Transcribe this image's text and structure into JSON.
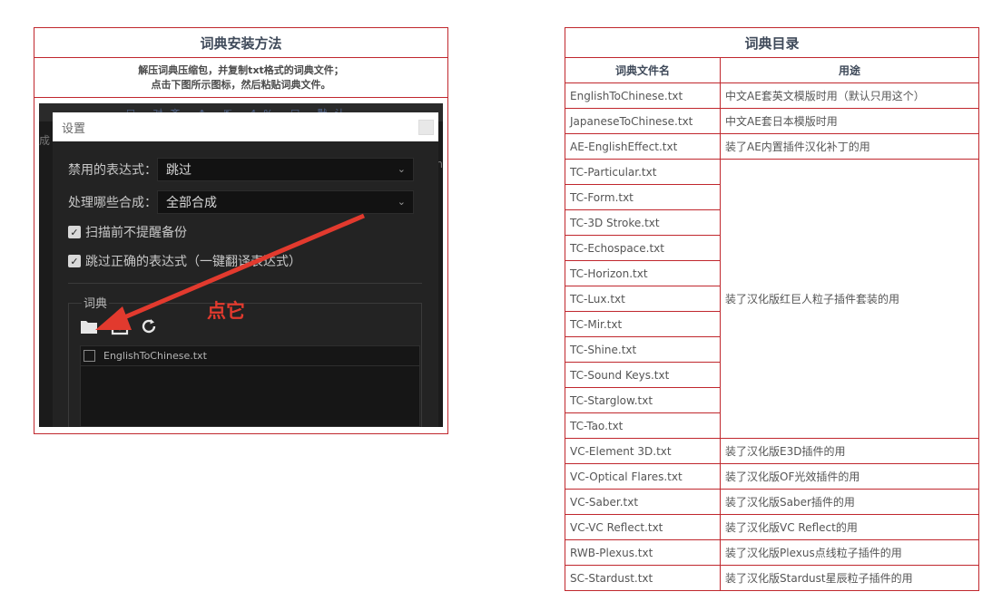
{
  "install": {
    "title": "词典安装方法",
    "desc_line1": "解压词典压缩包，并复制txt格式的词典文件；",
    "desc_line2": "点击下图所示图标，然后粘贴词典文件。"
  },
  "screenshot": {
    "bg_left_text": "成",
    "bg_right_text": "n",
    "bg_top_text": "☐ 对齐   ↕ ⇱   4%  ☐ 默认",
    "dialog_title": "设置",
    "disabled_expr_label": "禁用的表达式：",
    "disabled_expr_value": "跳过",
    "which_comps_label": "处理哪些合成：",
    "which_comps_value": "全部合成",
    "checkbox1_label": "扫描前不提醒备份",
    "checkbox2_label": "跳过正确的表达式（一键翻译表达式）",
    "dict_section_label": "词典",
    "file_item": "EnglishToChinese.txt",
    "annotation": "点它",
    "icons": [
      "folder-icon",
      "download-icon",
      "refresh-icon"
    ]
  },
  "dict_table": {
    "title": "词典目录",
    "col1_header": "词典文件名",
    "col2_header": "用途",
    "rows": [
      {
        "name": "EnglishToChinese.txt"
      },
      {
        "name": "JapaneseToChinese.txt"
      },
      {
        "name": "AE-EnglishEffect.txt"
      },
      {
        "name": "TC-Particular.txt"
      },
      {
        "name": "TC-Form.txt"
      },
      {
        "name": "TC-3D Stroke.txt"
      },
      {
        "name": "TC-Echospace.txt"
      },
      {
        "name": "TC-Horizon.txt"
      },
      {
        "name": "TC-Lux.txt"
      },
      {
        "name": "TC-Mir.txt"
      },
      {
        "name": "TC-Shine.txt"
      },
      {
        "name": "TC-Sound Keys.txt"
      },
      {
        "name": "TC-Starglow.txt"
      },
      {
        "name": "TC-Tao.txt"
      },
      {
        "name": "VC-Element 3D.txt"
      },
      {
        "name": "VC-Optical Flares.txt"
      },
      {
        "name": "VC-Saber.txt"
      },
      {
        "name": "VC-VC Reflect.txt"
      },
      {
        "name": "RWB-Plexus.txt"
      },
      {
        "name": "SC-Stardust.txt"
      }
    ],
    "uses": [
      {
        "text": "中文AE套英文模版时用（默认只用这个）",
        "rows": [
          0
        ]
      },
      {
        "text": "中文AE套日本模版时用",
        "rows": [
          1
        ]
      },
      {
        "text": "装了AE内置插件汉化补丁的用",
        "rows": [
          2
        ]
      },
      {
        "text": "装了汉化版红巨人粒子插件套装的用",
        "rows": [
          3,
          13
        ]
      },
      {
        "text": "装了汉化版E3D插件的用",
        "rows": [
          14
        ]
      },
      {
        "text": "装了汉化版OF光效插件的用",
        "rows": [
          15
        ]
      },
      {
        "text": "装了汉化版Saber插件的用",
        "rows": [
          16
        ]
      },
      {
        "text": "装了汉化版VC Reflect的用",
        "rows": [
          17
        ]
      },
      {
        "text": "装了汉化版Plexus点线粒子插件的用",
        "rows": [
          18
        ]
      },
      {
        "text": "装了汉化版Stardust星辰粒子插件的用",
        "rows": [
          19
        ]
      }
    ]
  }
}
